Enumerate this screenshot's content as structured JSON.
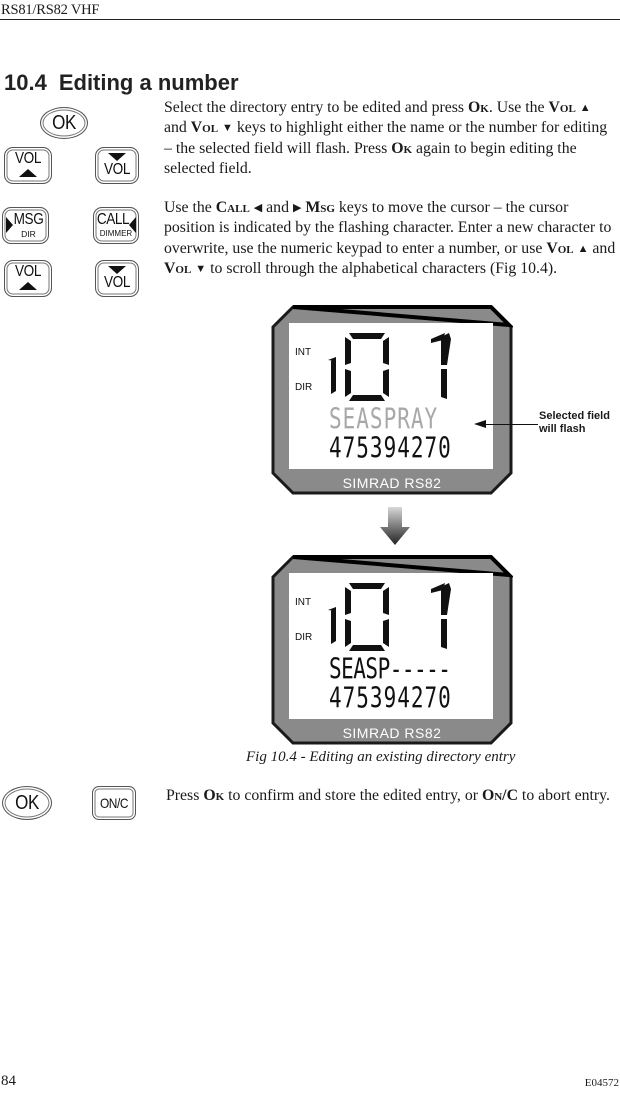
{
  "header": {
    "running_title": "RS81/RS82 VHF"
  },
  "section": {
    "number": "10.4",
    "title": "Editing a number"
  },
  "keys": {
    "ok": "OK",
    "vol": "VOL",
    "msg": "MSG",
    "msg_sub": "DIR",
    "call": "CALL",
    "call_sub": "DIMMER",
    "onc": "ON/C"
  },
  "paragraph1": {
    "t1": "Select the directory entry to be edited and press ",
    "ok1": "Ok",
    "t2": ". Use the ",
    "vol1": "Vol",
    "up": "▲",
    "t3": " and ",
    "vol2": "Vol",
    "down": "▼",
    "t4": " keys to highlight either the name or the number for editing – the selected field will flash. Press ",
    "ok2": "Ok",
    "t5": " again to begin editing the selected field."
  },
  "paragraph2": {
    "t1": "Use the ",
    "call": "Call",
    "left": "◀",
    "t2": " and ",
    "right": "▶",
    "msg": "Msg",
    "t3": " keys to move the cursor – the cursor position is indicated by the flashing character. Enter a new character to overwrite, use the numeric keypad to enter a number, or use ",
    "vol1": "Vol",
    "up": "▲",
    "t4": " and ",
    "vol2": "Vol",
    "down": "▼",
    "t5": " to scroll through the alphabetical characters (Fig 10.4)."
  },
  "figure": {
    "display_before": {
      "label_int": "INT",
      "label_dir": "DIR",
      "channel_prefix": "1",
      "channel": "01",
      "name": "SEASPRAY",
      "name_state": "flashing",
      "number": "475394270",
      "brand": "SIMRAD RS82"
    },
    "display_after": {
      "label_int": "INT",
      "label_dir": "DIR",
      "channel_prefix": "1",
      "channel": "01",
      "name": "SEASP-----",
      "number": "475394270",
      "brand": "SIMRAD RS82"
    },
    "callout": "Selected field will flash",
    "caption": "Fig 10.4 - Editing an existing directory entry",
    "colors": {
      "bezel": "#8a8a8a",
      "bezel_edge": "#1a1a1a",
      "flash_text": "#a8a8a8",
      "lcd_text": "#111111"
    }
  },
  "paragraph3": {
    "t1": "Press ",
    "ok": "Ok",
    "t2": " to confirm and store the edited entry, or ",
    "onc": "On/C",
    "t3": " to abort entry."
  },
  "footer": {
    "page_number": "84",
    "doc_code": "E04572"
  }
}
